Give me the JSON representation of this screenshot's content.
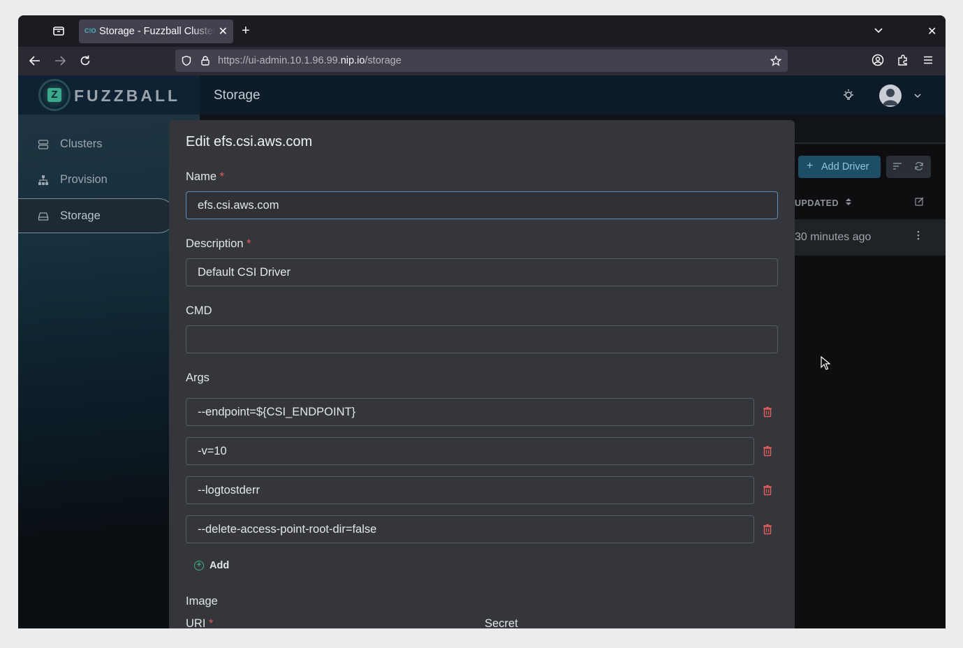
{
  "browser": {
    "tab_title": "Storage - Fuzzball Cluster",
    "tab_favicon": "C!O",
    "new_tab": "+",
    "close_tab": "✕",
    "close_window": "✕",
    "url_prefix": "https://ui-admin.10.1.96.99.",
    "url_host": "nip.io",
    "url_path": "/storage"
  },
  "app": {
    "logo": "FUZZBALL",
    "logo_letter": "Z",
    "page_title": "Storage"
  },
  "sidebar": {
    "items": [
      {
        "label": "Clusters",
        "icon": "server-icon"
      },
      {
        "label": "Provision",
        "icon": "sitemap-icon"
      },
      {
        "label": "Storage",
        "icon": "storage-icon"
      }
    ]
  },
  "background_page": {
    "add_driver_label": "Add Driver",
    "add_driver_icon": "+",
    "column_updated": "UPDATED",
    "row_updated": "30 minutes ago"
  },
  "modal": {
    "title": "Edit efs.csi.aws.com",
    "required_mark": "*",
    "name_label": "Name",
    "name_value": "efs.csi.aws.com",
    "description_label": "Description",
    "description_value": "Default CSI Driver",
    "cmd_label": "CMD",
    "cmd_value": "",
    "args_label": "Args",
    "args": [
      "--endpoint=${CSI_ENDPOINT}",
      "-v=10",
      "--logtostderr",
      "--delete-access-point-root-dir=false"
    ],
    "add_label": "Add",
    "add_icon": "+",
    "image_label": "Image",
    "uri_label": "URI",
    "secret_label": "Secret"
  }
}
